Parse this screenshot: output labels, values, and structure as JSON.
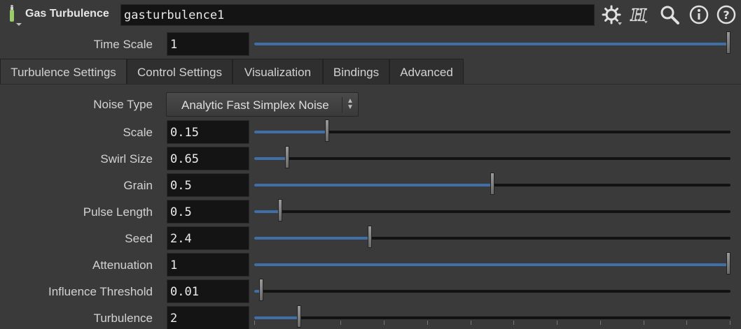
{
  "header": {
    "node_type": "Gas Turbulence",
    "node_name": "gasturbulence1",
    "icons": [
      "node-type-icon",
      "gear-icon",
      "houdini-help-icon",
      "search-icon",
      "info-icon",
      "help-icon"
    ]
  },
  "time_scale": {
    "label": "Time Scale",
    "value": "1",
    "slider_fraction": 1.0
  },
  "tabs": [
    {
      "label": "Turbulence Settings",
      "active": true
    },
    {
      "label": "Control Settings",
      "active": false
    },
    {
      "label": "Visualization",
      "active": false
    },
    {
      "label": "Bindings",
      "active": false
    },
    {
      "label": "Advanced",
      "active": false
    }
  ],
  "noise_type": {
    "label": "Noise Type",
    "value": "Analytic Fast Simplex Noise"
  },
  "params": [
    {
      "label": "Scale",
      "value": "0.15",
      "slider_fraction": 0.15
    },
    {
      "label": "Swirl Size",
      "value": "0.65",
      "slider_fraction": 0.065
    },
    {
      "label": "Grain",
      "value": "0.5",
      "slider_fraction": 0.5
    },
    {
      "label": "Pulse Length",
      "value": "0.5",
      "slider_fraction": 0.05
    },
    {
      "label": "Seed",
      "value": "2.4",
      "slider_fraction": 0.24
    },
    {
      "label": "Attenuation",
      "value": "1",
      "slider_fraction": 1.0
    },
    {
      "label": "Influence Threshold",
      "value": "0.01",
      "slider_fraction": 0.01
    },
    {
      "label": "Turbulence",
      "value": "2",
      "slider_fraction": 0.09
    }
  ],
  "colors": {
    "background": "#3a3a3a",
    "field": "#141414",
    "slider_fill": "#3f6fa6"
  }
}
